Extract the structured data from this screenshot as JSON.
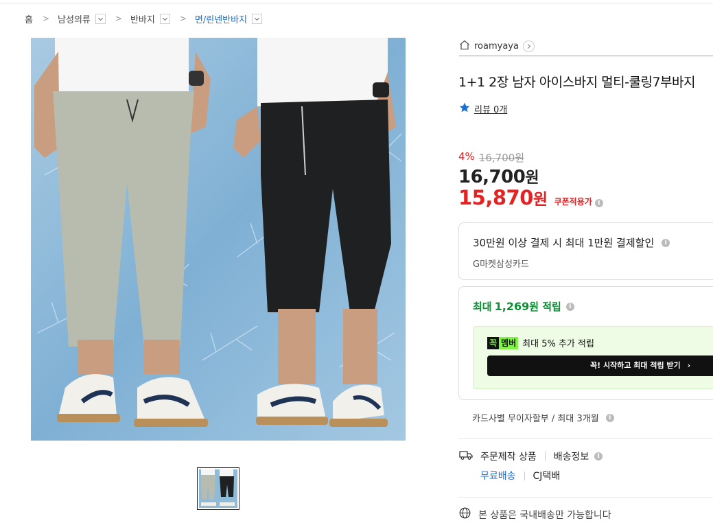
{
  "breadcrumb": [
    {
      "label": "홈",
      "has_dropdown": false
    },
    {
      "label": "남성의류",
      "has_dropdown": true
    },
    {
      "label": "반바지",
      "has_dropdown": true
    },
    {
      "label": "면/린넨반바지",
      "has_dropdown": true
    }
  ],
  "seller": {
    "name": "roamyaya"
  },
  "product": {
    "title": "1+1 2장 남자 아이스바지 멀티-쿨링7부바지",
    "review_label": "리뷰 0개",
    "discount_rate": "4%",
    "original_price": "16,700원",
    "price_num": "16,700",
    "price_unit": "원",
    "coupon_price_num": "15,870",
    "coupon_price_unit": "원",
    "coupon_label": "쿠폰적용가"
  },
  "card_promo": {
    "headline": "30만원 이상 결제 시 최대 1만원 결제할인",
    "card_name": "G마켓삼성카드"
  },
  "points": {
    "prefix": "최대 ",
    "amount": "1,269",
    "suffix": "원 적립",
    "badge_1": "꼭",
    "badge_2": "멤버",
    "member_text": "최대 5% 추가 적립",
    "cta_label": "꼭! 시작하고 최대 적립 받기",
    "cta_arrow": "›"
  },
  "installment": "카드사별 무이자할부 / 최대 3개월",
  "shipping": {
    "made_to_order": "주문제작 상품",
    "info_label": "배송정보",
    "free_shipping": "무료배송",
    "carrier": "CJ택배",
    "domestic_note": "본 상품은 국내배송만 가능합니다"
  },
  "colors": {
    "accent_blue": "#1a6fd4",
    "sale_red": "#e52222",
    "point_green": "#0a8f32",
    "member_lime": "#7cf541"
  }
}
